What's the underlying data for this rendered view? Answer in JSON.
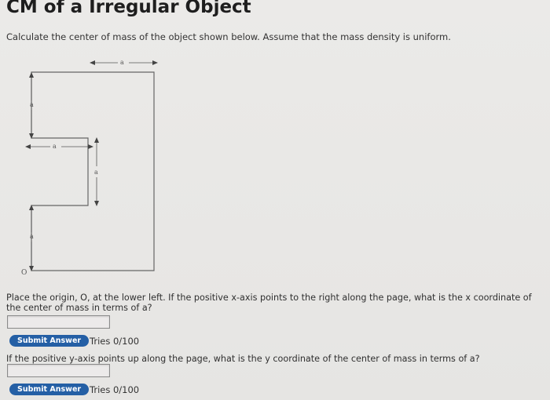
{
  "title": "CM of a Irregular Object",
  "instruction": "Calculate the center of mass of the object shown below. Assume that the mass density is uniform.",
  "figure": {
    "dimension_label": "a",
    "origin_label": "O"
  },
  "question1": {
    "text": "Place the origin, O, at the lower left. If the positive x-axis points to the right along the page, what is the x coordinate of the center of mass in terms of a?",
    "answer_value": "",
    "submit_label": "Submit Answer",
    "tries": "Tries 0/100"
  },
  "question2": {
    "text": "If the positive y-axis points up along the page, what is the y coordinate of the center of mass in terms of a?",
    "answer_value": "",
    "submit_label": "Submit Answer",
    "tries": "Tries 0/100"
  }
}
